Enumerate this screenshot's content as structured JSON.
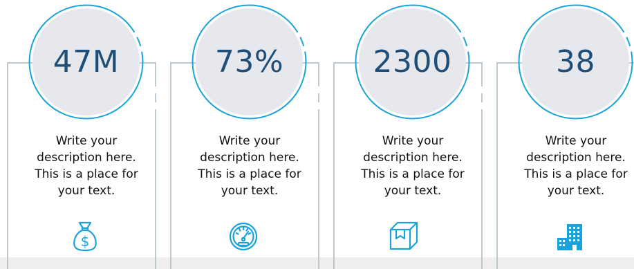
{
  "colors": {
    "accent": "#1aa3d9",
    "circle_fill": "#e6e8ed",
    "stat_text": "#1f4e79",
    "frame_line": "#a9b8c4"
  },
  "cards": [
    {
      "stat": "47M",
      "lines": [
        "Write your",
        "description here.",
        "This is a place for",
        "your text."
      ],
      "icon": "money-bag-icon"
    },
    {
      "stat": "73%",
      "lines": [
        "Write your",
        "description here.",
        "This is a place for",
        "your text."
      ],
      "icon": "speedometer-icon"
    },
    {
      "stat": "2300",
      "lines": [
        "Write your",
        "description here.",
        "This is a place for",
        "your text."
      ],
      "icon": "box-icon"
    },
    {
      "stat": "38",
      "lines": [
        "Write your",
        "description here.",
        "This is a place for",
        "your text."
      ],
      "icon": "building-icon"
    }
  ]
}
